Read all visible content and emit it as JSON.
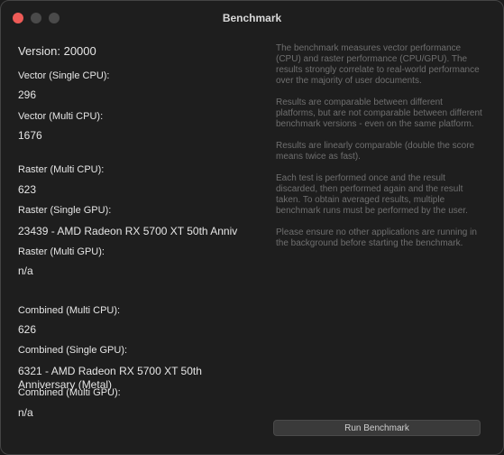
{
  "window": {
    "title": "Benchmark"
  },
  "version": "Version: 20000",
  "results": {
    "vector_single_cpu": {
      "label": "Vector (Single CPU):",
      "value": "296"
    },
    "vector_multi_cpu": {
      "label": "Vector (Multi CPU):",
      "value": "1676"
    },
    "raster_multi_cpu": {
      "label": "Raster (Multi CPU):",
      "value": "623"
    },
    "raster_single_gpu": {
      "label": "Raster (Single GPU):",
      "value": "23439 - AMD Radeon RX 5700 XT 50th Anniv"
    },
    "raster_multi_gpu": {
      "label": "Raster (Multi GPU):",
      "value": "n/a"
    },
    "combined_multi_cpu": {
      "label": "Combined (Multi CPU):",
      "value": "626"
    },
    "combined_single_gpu": {
      "label": "Combined (Single GPU):",
      "value": "6321 - AMD Radeon RX 5700 XT 50th Anniversary (Metal)"
    },
    "combined_multi_gpu": {
      "label": "Combined (Multi GPU):",
      "value": "n/a"
    }
  },
  "info": [
    "The benchmark measures vector performance (CPU) and raster performance (CPU/GPU). The results strongly correlate to real-world performance over the majority of user documents.",
    "Results are comparable between different platforms, but are not comparable between different benchmark versions - even on the same platform.",
    "Results are linearly comparable (double the score means twice as fast).",
    "Each test is performed once and the result discarded, then performed again and the result taken. To obtain averaged results, multiple benchmark runs must be performed by the user.",
    "Please ensure no other applications are running in the background before starting the benchmark."
  ],
  "run_button_label": "Run Benchmark"
}
